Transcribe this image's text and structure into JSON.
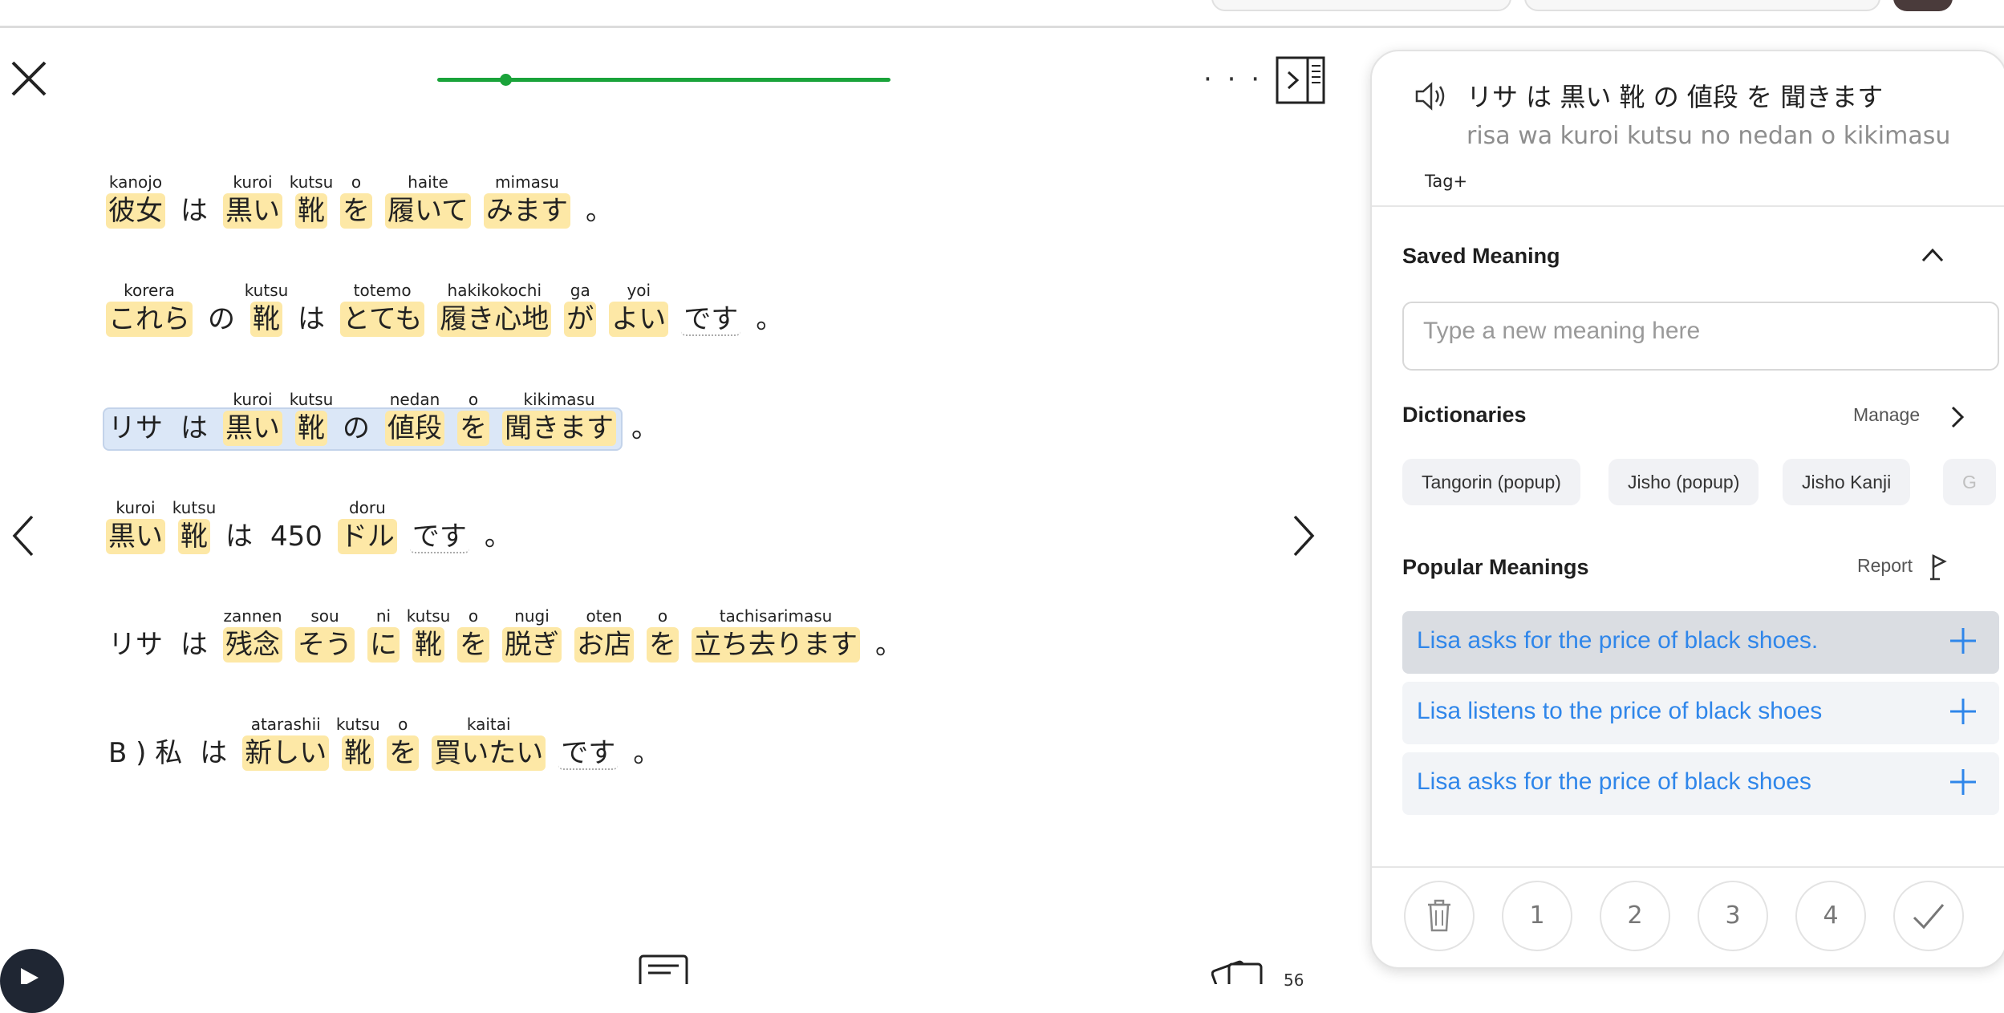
{
  "reader": {
    "close_icon": "close-icon",
    "more_label": "· · ·",
    "progress": 0.15,
    "lines": [
      {
        "tokens": [
          {
            "jp": "彼女",
            "reading": "kanojo",
            "hl": true
          },
          {
            "jp": "は",
            "reading": "",
            "hl": false
          },
          {
            "jp": "黒い",
            "reading": "kuroi",
            "hl": true
          },
          {
            "jp": "靴",
            "reading": "kutsu",
            "hl": true
          },
          {
            "jp": "を",
            "reading": "o",
            "hl": true
          },
          {
            "jp": "履いて",
            "reading": "haite",
            "hl": true
          },
          {
            "jp": "みます",
            "reading": "mimasu",
            "hl": true
          },
          {
            "jp": "。",
            "reading": "",
            "hl": false
          }
        ]
      },
      {
        "tokens": [
          {
            "jp": "これら",
            "reading": "korera",
            "hl": true
          },
          {
            "jp": "の",
            "reading": "",
            "hl": false
          },
          {
            "jp": "靴",
            "reading": "kutsu",
            "hl": true
          },
          {
            "jp": "は",
            "reading": "",
            "hl": false
          },
          {
            "jp": "とても",
            "reading": "totemo",
            "hl": true
          },
          {
            "jp": "履き心地",
            "reading": "hakikokochi",
            "hl": true
          },
          {
            "jp": "が",
            "reading": "ga",
            "hl": true
          },
          {
            "jp": "よい",
            "reading": "yoi",
            "hl": true
          },
          {
            "jp": "です",
            "reading": "",
            "hl": false,
            "dotted": true
          },
          {
            "jp": "。",
            "reading": "",
            "hl": false
          }
        ]
      },
      {
        "tokens": [
          {
            "jp": "リサ",
            "reading": "",
            "hl": false
          },
          {
            "jp": "は",
            "reading": "",
            "hl": false
          },
          {
            "jp": "黒い",
            "reading": "kuroi",
            "hl": true
          },
          {
            "jp": "靴",
            "reading": "kutsu",
            "hl": true
          },
          {
            "jp": "の",
            "reading": "",
            "hl": false
          },
          {
            "jp": "値段",
            "reading": "nedan",
            "hl": true
          },
          {
            "jp": "を",
            "reading": "o",
            "hl": true
          },
          {
            "jp": "聞きます",
            "reading": "kikimasu",
            "hl": true
          },
          {
            "jp": "。",
            "reading": "",
            "hl": false
          }
        ]
      },
      {
        "tokens": [
          {
            "jp": "黒い",
            "reading": "kuroi",
            "hl": true
          },
          {
            "jp": "靴",
            "reading": "kutsu",
            "hl": true
          },
          {
            "jp": "は",
            "reading": "",
            "hl": false
          },
          {
            "jp": "450",
            "reading": "",
            "hl": false
          },
          {
            "jp": "ドル",
            "reading": "doru",
            "hl": true
          },
          {
            "jp": "です",
            "reading": "",
            "hl": false,
            "dotted": true
          },
          {
            "jp": "。",
            "reading": "",
            "hl": false
          }
        ]
      },
      {
        "tokens": [
          {
            "jp": "リサ",
            "reading": "",
            "hl": false
          },
          {
            "jp": "は",
            "reading": "",
            "hl": false
          },
          {
            "jp": "残念",
            "reading": "zannen",
            "hl": true
          },
          {
            "jp": "そう",
            "reading": "sou",
            "hl": true
          },
          {
            "jp": "に",
            "reading": "ni",
            "hl": true
          },
          {
            "jp": "靴",
            "reading": "kutsu",
            "hl": true
          },
          {
            "jp": "を",
            "reading": "o",
            "hl": true
          },
          {
            "jp": "脱ぎ",
            "reading": "nugi",
            "hl": true
          },
          {
            "jp": "お店",
            "reading": "oten",
            "hl": true
          },
          {
            "jp": "を",
            "reading": "o",
            "hl": true
          },
          {
            "jp": "立ち去ります",
            "reading": "tachisarimasu",
            "hl": true
          },
          {
            "jp": "。",
            "reading": "",
            "hl": false
          }
        ]
      },
      {
        "tokens": [
          {
            "jp": "B ) 私",
            "reading": "",
            "hl": false
          },
          {
            "jp": "は",
            "reading": "",
            "hl": false
          },
          {
            "jp": "新しい",
            "reading": "atarashii",
            "hl": true
          },
          {
            "jp": "靴",
            "reading": "kutsu",
            "hl": true
          },
          {
            "jp": "を",
            "reading": "o",
            "hl": true
          },
          {
            "jp": "買いたい",
            "reading": "kaitai",
            "hl": true
          },
          {
            "jp": "です",
            "reading": "",
            "hl": false,
            "dotted": true
          },
          {
            "jp": "。",
            "reading": "",
            "hl": false
          }
        ]
      }
    ],
    "selected_line": 2
  },
  "bottom": {
    "cards_count": "56"
  },
  "panel": {
    "phrase_jp": "リサ は 黒い 靴 の 値段 を 聞きます",
    "phrase_romaji": "risa wa kuroi kutsu no nedan o kikimasu",
    "tag_label": "Tag+",
    "saved_title": "Saved Meaning",
    "meaning_placeholder": "Type a new meaning here",
    "dictionaries_title": "Dictionaries",
    "manage_label": "Manage",
    "dictionaries": [
      "Tangorin (popup)",
      "Jisho (popup)",
      "Jisho Kanji",
      "G"
    ],
    "popular_title": "Popular Meanings",
    "report_label": "Report",
    "meanings": [
      "Lisa asks for the price of black shoes.",
      "Lisa listens to the price of black shoes",
      "Lisa asks for the price of black shoes"
    ],
    "status_buttons": [
      "1",
      "2",
      "3",
      "4"
    ]
  },
  "colors": {
    "highlight": "#fde8a6",
    "selected_line": "#dbe7f7",
    "progress": "#1aa33a",
    "link_blue": "#2f86ea"
  }
}
